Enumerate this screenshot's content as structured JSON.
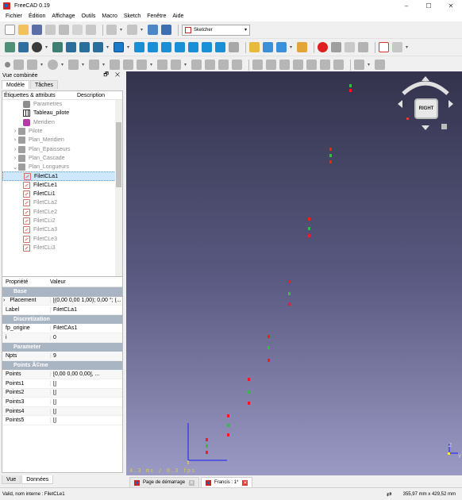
{
  "window": {
    "title": "FreeCAD 0.19",
    "controls": [
      "–",
      "☐",
      "✕"
    ]
  },
  "menu": [
    "Fichier",
    "Édition",
    "Affichage",
    "Outils",
    "Macro",
    "Sketch",
    "Fenêtre",
    "Aide"
  ],
  "toolbar": {
    "workbench": "Sketcher"
  },
  "combo_view": {
    "title": "Vue combinée",
    "title_buttons": "🗗 ✕",
    "tabs": [
      "Modèle",
      "Tâches"
    ],
    "tree_headers": [
      "Étiquettes & attributs",
      "Description"
    ],
    "tree": [
      {
        "label": "Parametres",
        "icon": "param-icon",
        "arrow": "",
        "indent": 2,
        "dim": true,
        "selected": false
      },
      {
        "label": "Tableau_pilote",
        "icon": "table-icon",
        "arrow": "",
        "indent": 2,
        "dim": false,
        "selected": false
      },
      {
        "label": "Meridien",
        "icon": "meridian-icon",
        "arrow": "",
        "indent": 2,
        "dim": true,
        "selected": false
      },
      {
        "label": "Pilote",
        "icon": "folder-icon",
        "arrow": "›",
        "indent": 1,
        "dim": true,
        "selected": false
      },
      {
        "label": "Plan_Meridien",
        "icon": "folder-icon",
        "arrow": "›",
        "indent": 1,
        "dim": true,
        "selected": false
      },
      {
        "label": "Plan_Epaisseurs",
        "icon": "folder-icon",
        "arrow": "›",
        "indent": 1,
        "dim": true,
        "selected": false
      },
      {
        "label": "Plan_Cascade",
        "icon": "folder-icon",
        "arrow": "›",
        "indent": 1,
        "dim": true,
        "selected": false
      },
      {
        "label": "Plan_Longueurs",
        "icon": "folder-icon",
        "arrow": "⌄",
        "indent": 1,
        "dim": true,
        "selected": false
      },
      {
        "label": "FiletCLa1",
        "icon": "sketch-icon",
        "arrow": "",
        "indent": 2,
        "dim": false,
        "selected": true
      },
      {
        "label": "FiletCLe1",
        "icon": "sketch-icon",
        "arrow": "",
        "indent": 2,
        "dim": false,
        "selected": false
      },
      {
        "label": "FiletCLi1",
        "icon": "sketch-icon",
        "arrow": "",
        "indent": 2,
        "dim": false,
        "selected": false
      },
      {
        "label": "FiletCLa2",
        "icon": "sketch-icon",
        "arrow": "",
        "indent": 2,
        "dim": true,
        "selected": false
      },
      {
        "label": "FiletCLe2",
        "icon": "sketch-icon",
        "arrow": "",
        "indent": 2,
        "dim": true,
        "selected": false
      },
      {
        "label": "FiletCLi2",
        "icon": "sketch-icon",
        "arrow": "",
        "indent": 2,
        "dim": true,
        "selected": false
      },
      {
        "label": "FiletCLa3",
        "icon": "sketch-icon",
        "arrow": "",
        "indent": 2,
        "dim": true,
        "selected": false
      },
      {
        "label": "FiletCLe3",
        "icon": "sketch-icon",
        "arrow": "",
        "indent": 2,
        "dim": true,
        "selected": false
      },
      {
        "label": "FiletCLi3",
        "icon": "sketch-icon",
        "arrow": "",
        "indent": 2,
        "dim": true,
        "selected": false
      }
    ],
    "property_headers": [
      "Propriété",
      "Valeur"
    ],
    "properties": [
      {
        "group": "Base"
      },
      {
        "key": "Placement",
        "value": "[(0,00 0,00 1,00); 0,00 °; (...",
        "expand": "›"
      },
      {
        "key": "Label",
        "value": "FiletCLa1"
      },
      {
        "group": "Discretization"
      },
      {
        "key": "fp_origine",
        "value": "FiletCAs1"
      },
      {
        "key": "i",
        "value": "0"
      },
      {
        "group": "Parameter"
      },
      {
        "key": "Npts",
        "value": "9"
      },
      {
        "group": "Points Ã©me"
      },
      {
        "key": "Points",
        "value": "[0,00 0,00 0,00], ..."
      },
      {
        "key": "Points1",
        "value": "[]"
      },
      {
        "key": "Points2",
        "value": "[]"
      },
      {
        "key": "Points3",
        "value": "[]"
      },
      {
        "key": "Points4",
        "value": "[]"
      },
      {
        "key": "Points5",
        "value": "[]"
      }
    ],
    "bottom_tabs": [
      "Vue",
      "Données"
    ]
  },
  "viewport": {
    "fps": "4.3 ms / 0.3 fps",
    "navcube_face": "RIGHT",
    "axis_labels": {
      "z": "Z",
      "y": "Y"
    },
    "point_colors": {
      "endpoint": "#ff1a1a",
      "midpoint": "#2fbf3a"
    }
  },
  "view_tabs": [
    {
      "label": "Page de démarrage",
      "active": false
    },
    {
      "label": "Francis : 1*",
      "active": true
    }
  ],
  "status": {
    "message": "Valid, nom interne : FiletCLe1",
    "dimensions": "355,97 mm x 429,52 mm"
  }
}
